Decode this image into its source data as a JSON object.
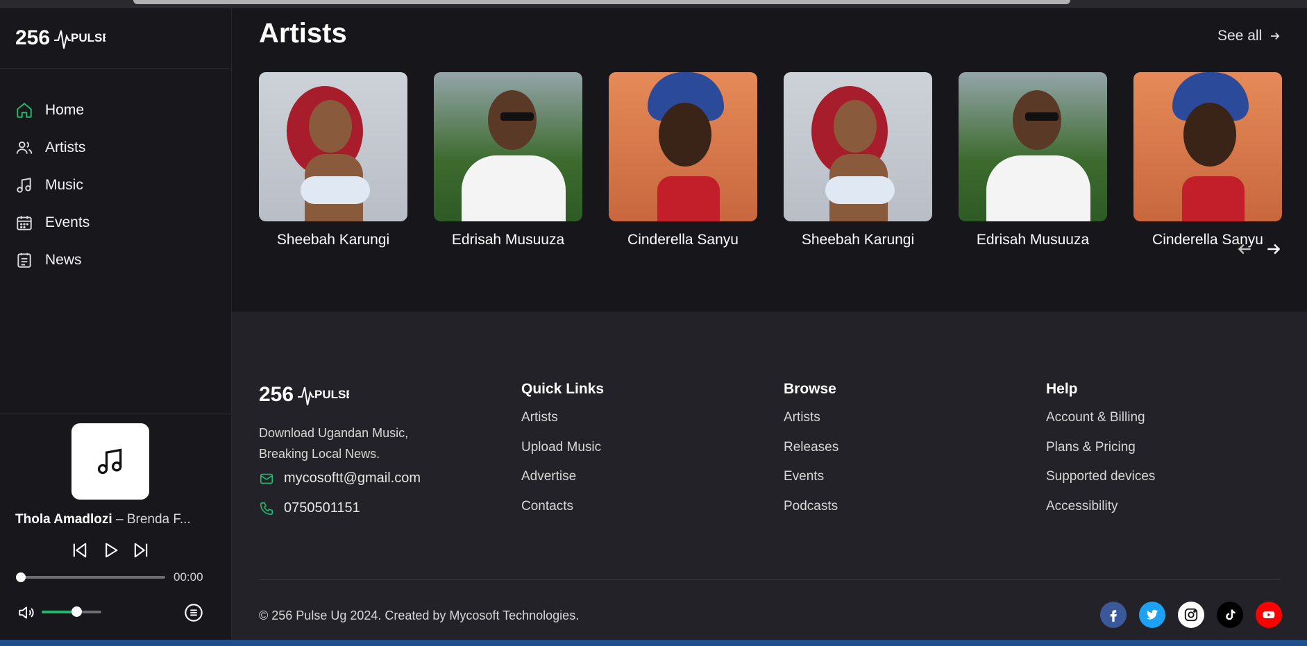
{
  "app": {
    "logo_text": "256 PULSE"
  },
  "sidebar": {
    "items": [
      {
        "label": "Home",
        "icon": "home-icon"
      },
      {
        "label": "Artists",
        "icon": "users-icon"
      },
      {
        "label": "Music",
        "icon": "music-icon"
      },
      {
        "label": "Events",
        "icon": "calendar-icon"
      },
      {
        "label": "News",
        "icon": "news-icon"
      }
    ],
    "accent": "#23b86d"
  },
  "player": {
    "title": "Thola Amadlozi",
    "separator": " – ",
    "artist": "Brenda F...",
    "time": "00:00",
    "progress": 0.0,
    "volume": 0.5
  },
  "main": {
    "section_title": "Artists",
    "see_all": "See all",
    "artists": [
      {
        "name": "Sheebah Karungi"
      },
      {
        "name": "Edrisah Musuuza"
      },
      {
        "name": "Cinderella Sanyu"
      },
      {
        "name": "Sheebah Karungi"
      },
      {
        "name": "Edrisah Musuuza"
      },
      {
        "name": "Cinderella Sanyu"
      }
    ]
  },
  "footer": {
    "tagline_line1": "Download Ugandan Music,",
    "tagline_line2": "Breaking Local News.",
    "email": "mycosoftt@gmail.com",
    "phone": "0750501151",
    "columns": [
      {
        "title": "Quick Links",
        "links": [
          "Artists",
          "Upload Music",
          "Advertise",
          "Contacts"
        ]
      },
      {
        "title": "Browse",
        "links": [
          "Artists",
          "Releases",
          "Events",
          "Podcasts"
        ]
      },
      {
        "title": "Help",
        "links": [
          "Account & Billing",
          "Plans & Pricing",
          "Supported devices",
          "Accessibility"
        ]
      }
    ],
    "copyright": "© 256 Pulse Ug 2024. Created by Mycosoft Technologies.",
    "socials": [
      {
        "name": "facebook-icon",
        "color": "#3b5998"
      },
      {
        "name": "twitter-icon",
        "color": "#1da1f2"
      },
      {
        "name": "instagram-icon",
        "color": "#ffffff"
      },
      {
        "name": "tiktok-icon",
        "color": "#000000"
      },
      {
        "name": "youtube-icon",
        "color": "#ff0000"
      }
    ]
  }
}
